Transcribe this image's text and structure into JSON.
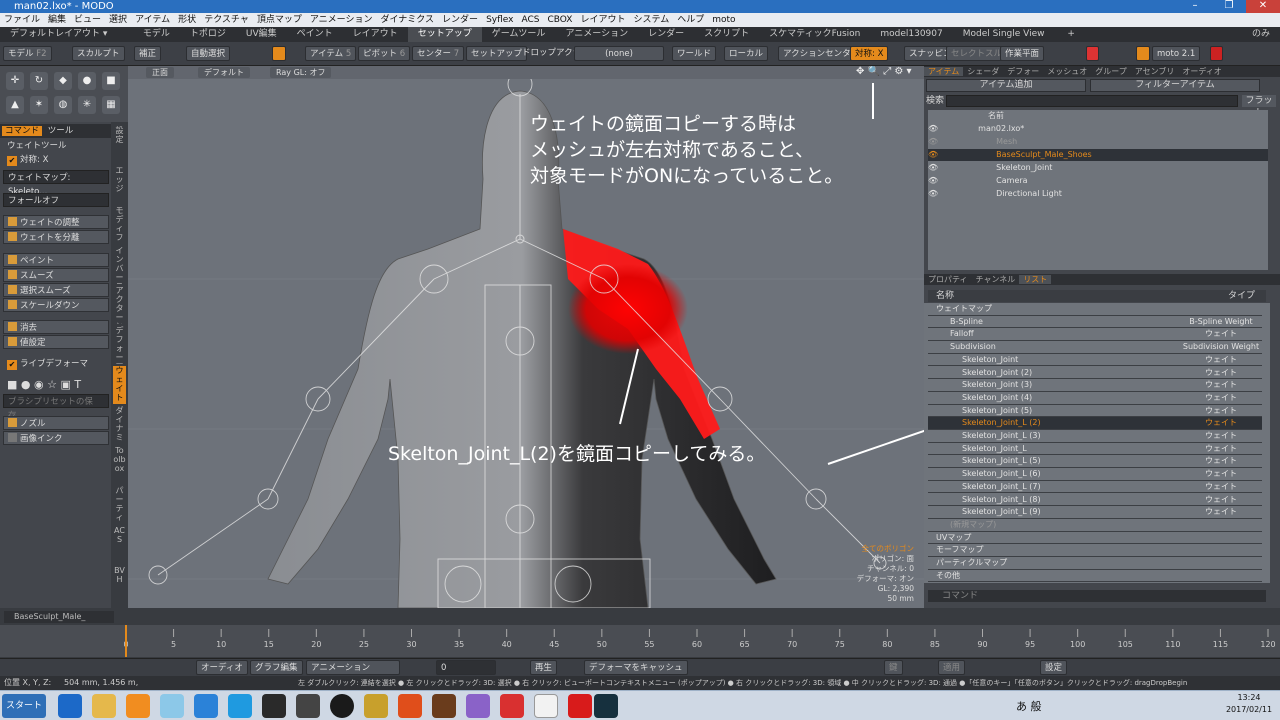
{
  "window": {
    "title": "man02.lxo* - MODO",
    "min": "–",
    "max": "❐",
    "close": "✕"
  },
  "menu": [
    "ファイル",
    "編集",
    "ビュー",
    "選択",
    "アイテム",
    "形状",
    "テクスチャ",
    "頂点マップ",
    "アニメーション",
    "ダイナミクス",
    "レンダー",
    "Syflex",
    "ACS",
    "CBOX",
    "レイアウト",
    "システム",
    "ヘルプ",
    "moto"
  ],
  "layoutbar": {
    "layout": "デフォルトレイアウト ▾",
    "tabs": [
      "モデル",
      "トポロジ",
      "UV編集",
      "ペイント",
      "レイアウト",
      "セットアップ",
      "ゲームツール",
      "アニメーション",
      "レンダー",
      "スクリプト",
      "スケマティックFusion",
      "model130907",
      "Model Single View"
    ],
    "active": 5,
    "add": "+",
    "right": "のみ"
  },
  "toolbar": {
    "model": "モデル",
    "model_key": "F2",
    "sculpt": "スカルプト",
    "correct": "補正",
    "autoselect": "自動選択",
    "item": "アイテム",
    "item_key": "5",
    "pivot": "ピボット",
    "pivot_key": "6",
    "center": "センター",
    "center_key": "7",
    "setup": "セットアップ",
    "dropaction": "ドロップアクション",
    "none": "(none)",
    "world": "ワールド",
    "local": "ローカル",
    "actioncenter": "アクションセンター",
    "symmetry": "対称: X",
    "snapping": "スナッピング",
    "selectthru": "セレクトスルー",
    "workplane": "作業平面",
    "moto": "moto 2.1"
  },
  "left": {
    "tabs": [
      "コマンド",
      "ツール"
    ],
    "tool": "ウェイトツール",
    "symmetry": "対称: X",
    "weightmap_label": "ウェイトマップ:",
    "weightmap_value": "Skeleto...",
    "falloff": "フォールオフ",
    "adjust": "ウェイトの調整",
    "split": "ウェイトを分離",
    "paint": "ペイント",
    "smooth": "スムーズ",
    "selsmooth": "選択スムーズ",
    "scaledown": "スケールダウン",
    "erase": "消去",
    "setvalue": "値設定",
    "livedeformer": "ライブデフォーマ",
    "brushpreset": "ブラシプリセットの保存...",
    "nozzle": "ノズル",
    "imageink": "画像インク"
  },
  "vtabs": [
    "設定",
    "エッジ",
    "モディファイ",
    "インバースキネマ",
    "アクターとセ",
    "デフォーマ",
    "ウェイト",
    "ダイナミ",
    "Toolbox",
    "パーティ",
    "ACS",
    "BVH"
  ],
  "viewport": {
    "view": "正面",
    "shading": "デフォルト",
    "raygl": "Ray GL: オフ",
    "annotation_top": [
      "ウェイトの鏡面コピーする時は",
      "メッシュが左右対称であること、",
      "対象モードがONになっていること。"
    ],
    "annotation_mid": "Skelton_Joint_L(2)を鏡面コピーしてみる。",
    "stats": [
      "全てのポリゴン",
      "ポリゴン: 面",
      "チャンネル: 0",
      "デフォーマ: オン",
      "GL: 2,390",
      "50 mm"
    ]
  },
  "items": {
    "tabs": [
      "アイテム",
      "シェーダ",
      "デフォー",
      "メッシュオ",
      "グループ",
      "アセンブリ",
      "オーディオ"
    ],
    "add": "アイテム追加",
    "filter": "フィルターアイテム",
    "search": "検索",
    "flat": "フラット",
    "header": "名前",
    "rows": [
      "man02.lxo*",
      "Mesh",
      "BaseSculpt_Male_Shoes",
      "Skeleton_Joint",
      "Camera",
      "Directional Light"
    ]
  },
  "list": {
    "tabs": [
      "プロパティ",
      "チャンネル",
      "リスト"
    ],
    "col_name": "名称",
    "col_type": "タイプ",
    "rows": [
      [
        "ウェイトマップ",
        ""
      ],
      [
        "B-Spline",
        "B-Spline Weight"
      ],
      [
        "Falloff",
        "ウェイト"
      ],
      [
        "Subdivision",
        "Subdivision Weight"
      ],
      [
        "Skeleton_Joint",
        "ウェイト"
      ],
      [
        "Skeleton_Joint (2)",
        "ウェイト"
      ],
      [
        "Skeleton_Joint (3)",
        "ウェイト"
      ],
      [
        "Skeleton_Joint (4)",
        "ウェイト"
      ],
      [
        "Skeleton_Joint (5)",
        "ウェイト"
      ],
      [
        "Skeleton_Joint_L (2)",
        "ウェイト"
      ],
      [
        "Skeleton_Joint_L (3)",
        "ウェイト"
      ],
      [
        "Skeleton_Joint_L",
        "ウェイト"
      ],
      [
        "Skeleton_Joint_L (5)",
        "ウェイト"
      ],
      [
        "Skeleton_Joint_L (6)",
        "ウェイト"
      ],
      [
        "Skeleton_Joint_L (7)",
        "ウェイト"
      ],
      [
        "Skeleton_Joint_L (8)",
        "ウェイト"
      ],
      [
        "Skeleton_Joint_L (9)",
        "ウェイト"
      ],
      [
        "(新規マップ)",
        ""
      ],
      [
        "UVマップ",
        ""
      ],
      [
        "モーフマップ",
        ""
      ],
      [
        "パーティクルマップ",
        ""
      ],
      [
        "その他",
        ""
      ]
    ],
    "selected": 9,
    "command": "コマンド"
  },
  "timeline": {
    "item": "BaseSculpt_Male_",
    "ticks": [
      "0",
      "5",
      "10",
      "15",
      "20",
      "25",
      "30",
      "35",
      "40",
      "45",
      "50",
      "55",
      "60",
      "65",
      "70",
      "75",
      "80",
      "85",
      "90",
      "95",
      "100",
      "105",
      "110",
      "115",
      "120"
    ]
  },
  "transport": {
    "audio": "オーディオ",
    "graph": "グラフ編集",
    "anim": "アニメーション",
    "frame": "0",
    "play": "再生",
    "cache": "デフォーマをキャッシュ",
    "key": "鍵",
    "apply": "適用",
    "settings": "設定"
  },
  "status": {
    "pos": "位置 X, Y, Z:",
    "posval": "504 mm, 1.456 m,",
    "hint": "左 ダブルクリック: 連結を選択 ● 左 クリックとドラッグ: 3D: 選択 ● 右 クリック: ビューポートコンテキストメニュー (ポップアップ) ● 右 クリックとドラッグ: 3D: 領域 ● 中 クリックとドラッグ: 3D: 通過 ●「任意のキー」「任意のボタン」クリックとドラッグ: dragDropBegin"
  },
  "taskbar": {
    "start": "スタート",
    "time": "13:24",
    "date": "2017/02/11",
    "ime": "あ 般"
  }
}
